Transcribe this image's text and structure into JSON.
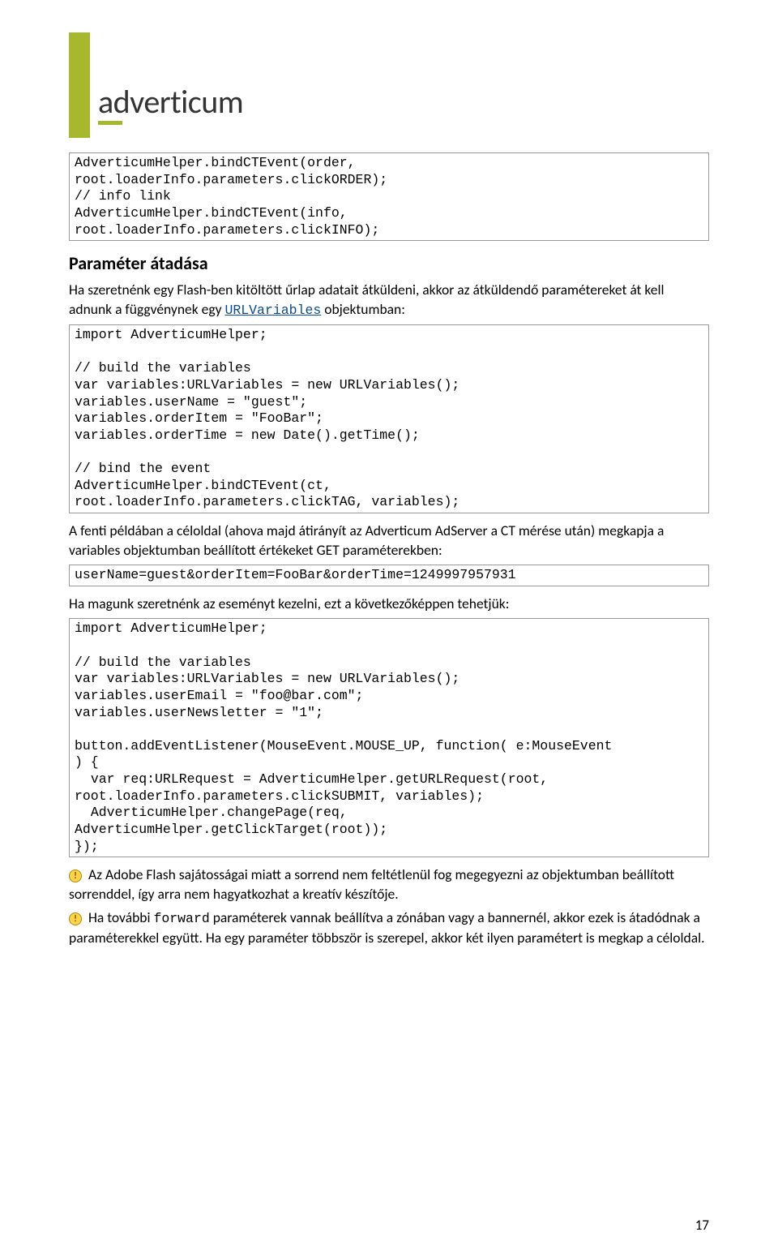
{
  "logo": {
    "word": "adverticum"
  },
  "code1": "AdverticumHelper.bindCTEvent(order,\nroot.loaderInfo.parameters.clickORDER);\n// info link\nAdverticumHelper.bindCTEvent(info,\nroot.loaderInfo.parameters.clickINFO);",
  "heading1": "Paraméter átadása",
  "para1_pre": "Ha szeretnénk egy Flash-ben kitöltött űrlap adatait átküldeni, akkor az átküldendő paramétereket át kell adnunk a függvénynek egy ",
  "para1_link": "URLVariables",
  "para1_post": " objektumban:",
  "code2": "import AdverticumHelper;\n\n// build the variables\nvar variables:URLVariables = new URLVariables();\nvariables.userName = \"guest\";\nvariables.orderItem = \"FooBar\";\nvariables.orderTime = new Date().getTime();\n\n// bind the event\nAdverticumHelper.bindCTEvent(ct,\nroot.loaderInfo.parameters.clickTAG, variables);",
  "para2": "A fenti példában a céloldal (ahova majd átirányít az Adverticum AdServer a CT mérése után) megkapja a variables objektumban beállított értékeket GET paraméterekben:",
  "code3": "userName=guest&orderItem=FooBar&orderTime=1249997957931",
  "para3": "Ha magunk szeretnénk az eseményt kezelni, ezt a következőképpen tehetjük:",
  "code4": "import AdverticumHelper;\n\n// build the variables\nvar variables:URLVariables = new URLVariables();\nvariables.userEmail = \"foo@bar.com\";\nvariables.userNewsletter = \"1\";\n\nbutton.addEventListener(MouseEvent.MOUSE_UP, function( e:MouseEvent\n) {\n  var req:URLRequest = AdverticumHelper.getURLRequest(root,\nroot.loaderInfo.parameters.clickSUBMIT, variables);\n  AdverticumHelper.changePage(req,\nAdverticumHelper.getClickTarget(root));\n});",
  "warn1": " Az Adobe Flash sajátosságai miatt a sorrend nem feltétlenül fog megegyezni az objektumban beállított sorrenddel, így arra nem hagyatkozhat a kreatív készítője.",
  "warn2_pre": " Ha további ",
  "warn2_mono": "forward",
  "warn2_post": " paraméterek vannak beállítva a zónában vagy a bannernél, akkor ezek is átadódnak a paraméterekkel együtt. Ha egy paraméter többször is szerepel, akkor két ilyen paramétert is megkap a céloldal.",
  "page_number": "17"
}
